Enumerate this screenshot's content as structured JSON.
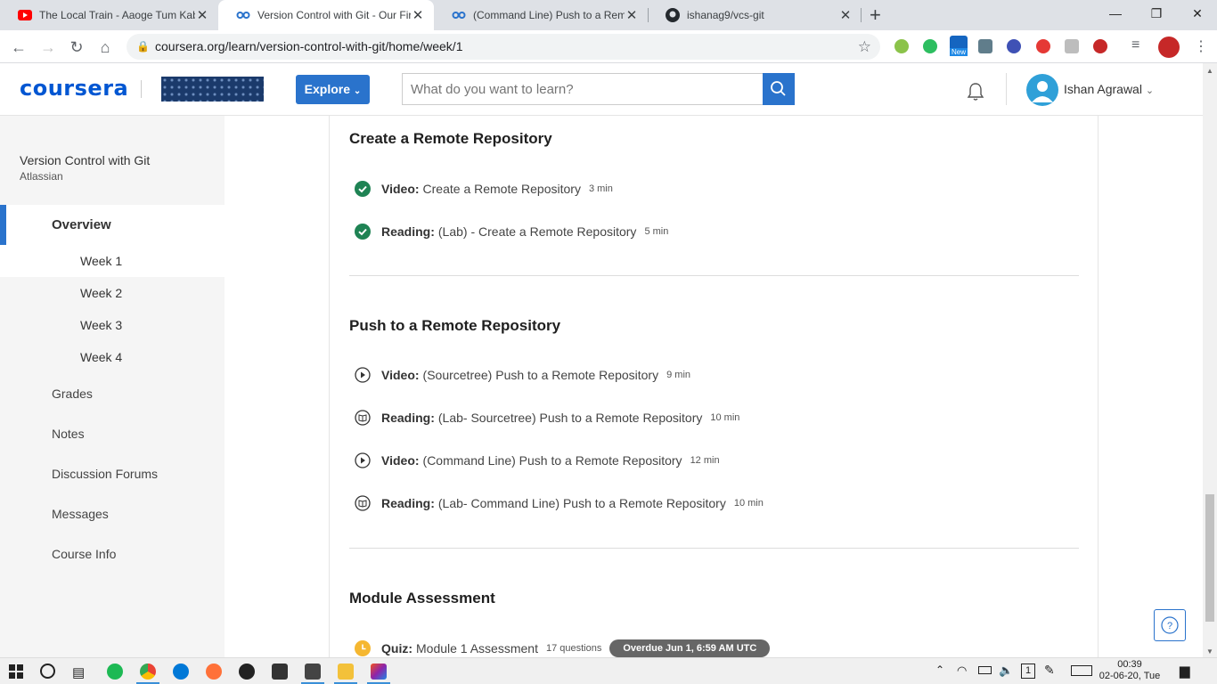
{
  "browser": {
    "tabs": [
      {
        "title": "The Local Train - Aaoge Tum Kab",
        "icon": "youtube-icon"
      },
      {
        "title": "Version Control with Git - Our Fir",
        "icon": "coursera-icon"
      },
      {
        "title": "(Command Line) Push to a Remo",
        "icon": "coursera-icon"
      },
      {
        "title": "ishanag9/vcs-git",
        "icon": "github-icon"
      }
    ],
    "new_tab": "+",
    "url": "coursera.org/learn/version-control-with-git/home/week/1",
    "ext_new_badge": "New"
  },
  "header": {
    "logo": "coursera",
    "explore_label": "Explore",
    "search_placeholder": "What do you want to learn?",
    "user_name": "Ishan Agrawal"
  },
  "sidebar": {
    "course_title": "Version Control with Git",
    "partner": "Atlassian",
    "overview": "Overview",
    "weeks": [
      "Week 1",
      "Week 2",
      "Week 3",
      "Week 4"
    ],
    "items": [
      "Grades",
      "Notes",
      "Discussion Forums",
      "Messages",
      "Course Info"
    ]
  },
  "main": {
    "sections": [
      {
        "title": "Create a Remote Repository"
      },
      {
        "title": "Push to a Remote Repository"
      },
      {
        "title": "Module Assessment"
      }
    ],
    "items": [
      {
        "type": "Video:",
        "title": "Create a Remote Repository",
        "dur": "3 min",
        "status": "completed"
      },
      {
        "type": "Reading:",
        "title": "(Lab) - Create a Remote Repository",
        "dur": "5 min",
        "status": "completed"
      },
      {
        "type": "Video:",
        "title": "(Sourcetree) Push to a Remote Repository",
        "dur": "9 min",
        "status": "video"
      },
      {
        "type": "Reading:",
        "title": "(Lab- Sourcetree) Push to a Remote Repository",
        "dur": "10 min",
        "status": "reading"
      },
      {
        "type": "Video:",
        "title": "(Command Line) Push to a Remote Repository",
        "dur": "12 min",
        "status": "video"
      },
      {
        "type": "Reading:",
        "title": "(Lab- Command Line) Push to a Remote Repository",
        "dur": "10 min",
        "status": "reading"
      },
      {
        "type": "Quiz:",
        "title": "Module 1 Assessment",
        "dur": "17 questions",
        "status": "quiz",
        "badge": "Overdue Jun 1, 6:59 AM UTC"
      }
    ]
  },
  "taskbar": {
    "time": "00:39",
    "date": "02-06-20, Tue",
    "notif_count": "1"
  },
  "colors": {
    "accent": "#2a73cc",
    "completed": "#1f8354",
    "quiz": "#f5b731"
  }
}
